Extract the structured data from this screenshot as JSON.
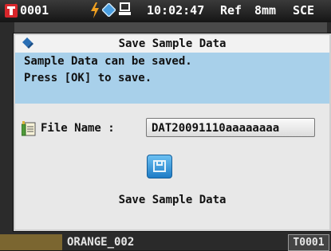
{
  "status_bar": {
    "target_number": "0001",
    "time": "10:02:47",
    "ref": "Ref",
    "area": "8mm",
    "mode": "SCE"
  },
  "dialog": {
    "title": "Save Sample Data",
    "message_line1": "Sample Data can be saved.",
    "message_line2": "Press [OK] to save.",
    "file_name_label": "File Name :",
    "file_name_value": "DAT20091110aaaaaaaa",
    "save_button_label": "Save Sample Data"
  },
  "bottom_bar": {
    "sample_name": "ORANGE_002",
    "target_id": "T0001"
  },
  "colors": {
    "accent": "#a8d0ea",
    "status_red": "#d8262b",
    "button_blue": "#1e7cc6"
  }
}
